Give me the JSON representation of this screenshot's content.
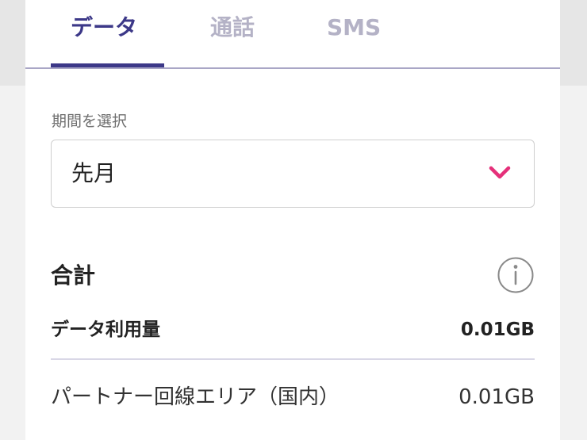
{
  "tabs": [
    {
      "label": "データ",
      "active": true
    },
    {
      "label": "通話",
      "active": false
    },
    {
      "label": "SMS",
      "active": false
    }
  ],
  "period": {
    "label": "期間を選択",
    "selected": "先月"
  },
  "summary": {
    "title": "合計",
    "total_label": "データ利用量",
    "total_value": "0.01GB",
    "rows": [
      {
        "label": "パートナー回線エリア（国内）",
        "value": "0.01GB"
      }
    ]
  },
  "colors": {
    "accent": "#3c3888",
    "inactive_tab": "#b4b2c6",
    "chevron": "#e5307a",
    "border": "#cfcfcf"
  },
  "icons": {
    "dropdown": "chevron-down-icon",
    "info": "info-icon"
  }
}
